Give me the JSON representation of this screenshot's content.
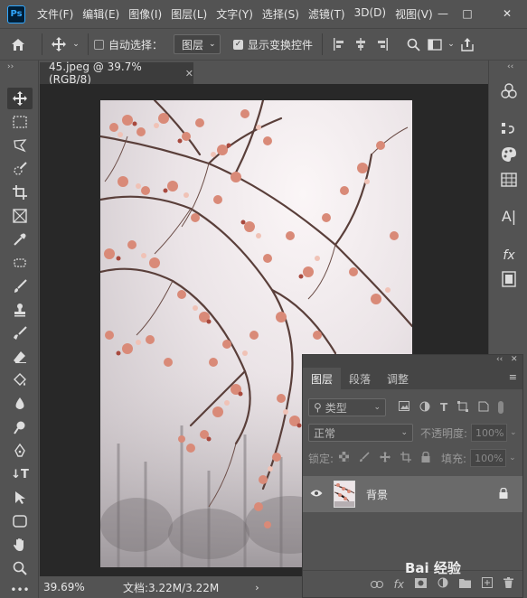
{
  "app": {
    "logo_text": "Ps"
  },
  "menu": [
    "文件(F)",
    "编辑(E)",
    "图像(I)",
    "图层(L)",
    "文字(Y)",
    "选择(S)",
    "滤镜(T)",
    "3D(D)",
    "视图(V)"
  ],
  "window_controls": {
    "minimize": "—",
    "maximize": "□",
    "close": "✕"
  },
  "options_bar": {
    "auto_select_label": "自动选择：",
    "auto_select_checked": false,
    "auto_select_target": "图层",
    "show_transform_label": "显示变换控件",
    "show_transform_checked": true
  },
  "document": {
    "tab_title": "45.jpeg @ 39.7%(RGB/8)",
    "zoom": "39.69%",
    "doc_info": "文档:3.22M/3.22M"
  },
  "layers_panel": {
    "tabs": [
      "图层",
      "段落",
      "调整"
    ],
    "active_tab": "图层",
    "filter_kind": "类型",
    "blend_mode": "正常",
    "opacity_label": "不透明度:",
    "opacity_value": "100%",
    "lock_label": "锁定:",
    "fill_label": "填充:",
    "fill_value": "100%",
    "layer_name": "背景",
    "bottom_fx": "fx"
  },
  "watermark": "Bai 经验",
  "colors": {
    "ui_bg": "#535353",
    "canvas_bg": "#282828",
    "accent": "#31a8ff"
  }
}
